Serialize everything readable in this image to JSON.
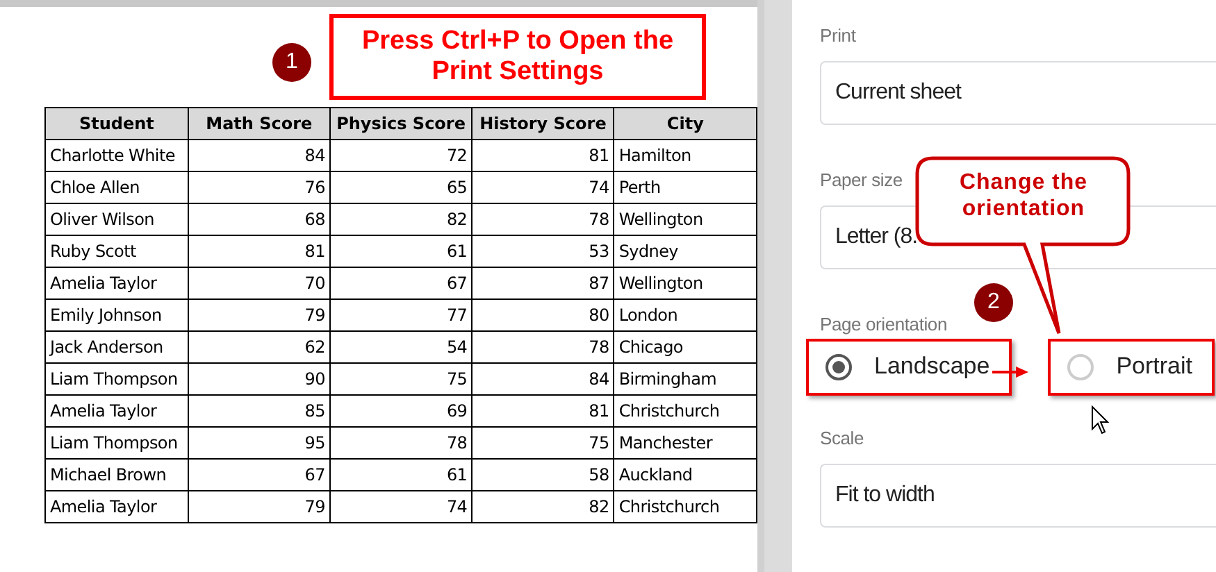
{
  "sheet": {
    "columns": [
      "Student",
      "Math Score",
      "Physics Score",
      "History Score",
      "City"
    ],
    "rows": [
      [
        "Charlotte White",
        "84",
        "72",
        "81",
        "Hamilton"
      ],
      [
        "Chloe Allen",
        "76",
        "65",
        "74",
        "Perth"
      ],
      [
        "Oliver Wilson",
        "68",
        "82",
        "78",
        "Wellington"
      ],
      [
        "Ruby Scott",
        "81",
        "61",
        "53",
        "Sydney"
      ],
      [
        "Amelia Taylor",
        "70",
        "67",
        "87",
        "Wellington"
      ],
      [
        "Emily Johnson",
        "79",
        "77",
        "80",
        "London"
      ],
      [
        "Jack Anderson",
        "62",
        "54",
        "78",
        "Chicago"
      ],
      [
        "Liam Thompson",
        "90",
        "75",
        "84",
        "Birmingham"
      ],
      [
        "Amelia Taylor",
        "85",
        "69",
        "81",
        "Christchurch"
      ],
      [
        "Liam Thompson",
        "95",
        "78",
        "75",
        "Manchester"
      ],
      [
        "Michael Brown",
        "67",
        "61",
        "58",
        "Auckland"
      ],
      [
        "Amelia Taylor",
        "79",
        "74",
        "82",
        "Christchurch"
      ]
    ]
  },
  "print_settings": {
    "print": {
      "label": "Print",
      "value": "Current sheet"
    },
    "paper_size": {
      "label": "Paper size",
      "value": "Letter (8."
    },
    "orientation": {
      "label": "Page orientation",
      "options": [
        {
          "label": "Landscape",
          "selected": true
        },
        {
          "label": "Portrait",
          "selected": false
        }
      ]
    },
    "scale": {
      "label": "Scale",
      "value": "Fit to width"
    }
  },
  "annotations": {
    "instruction": "Press Ctrl+P to Open the Print Settings",
    "callout": "Change the orientation",
    "step_badges": [
      "1",
      "2"
    ]
  }
}
